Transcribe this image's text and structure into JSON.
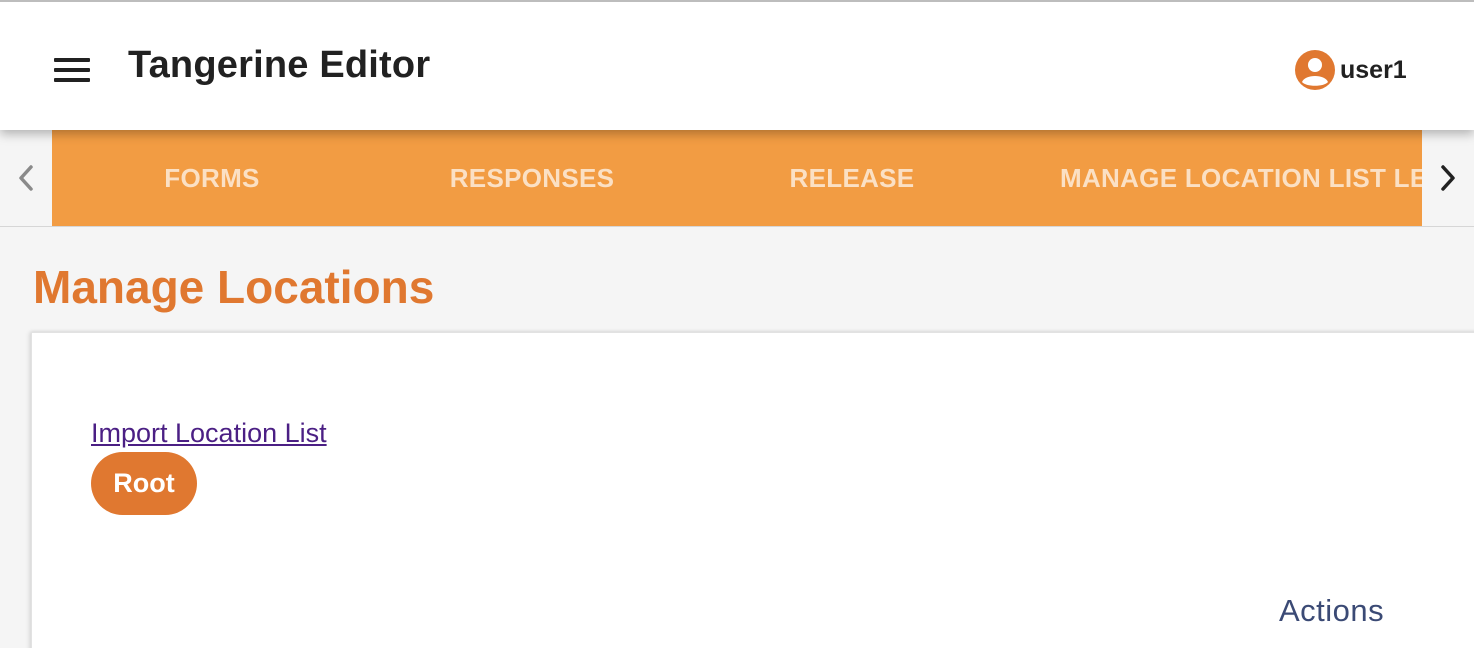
{
  "header": {
    "menu_icon": "hamburger-menu-icon",
    "title": "Tangerine Editor",
    "user": {
      "icon": "account-circle-icon",
      "name": "user1"
    }
  },
  "tabs": {
    "nav_left_icon": "chevron-left-icon",
    "nav_right_icon": "chevron-right-icon",
    "items": [
      {
        "label": "FORMS"
      },
      {
        "label": "RESPONSES"
      },
      {
        "label": "RELEASE"
      },
      {
        "label": "MANAGE LOCATION LIST LE"
      }
    ]
  },
  "main": {
    "page_title": "Manage Locations",
    "import_link": "Import Location List",
    "root_button": "Root",
    "actions_label": "Actions"
  },
  "colors": {
    "accent_orange": "#e07830",
    "tab_bar": "#f29c43",
    "tab_text": "#fbe0c4",
    "link_purple": "#4b1f84",
    "actions_text": "#3b4a75"
  }
}
